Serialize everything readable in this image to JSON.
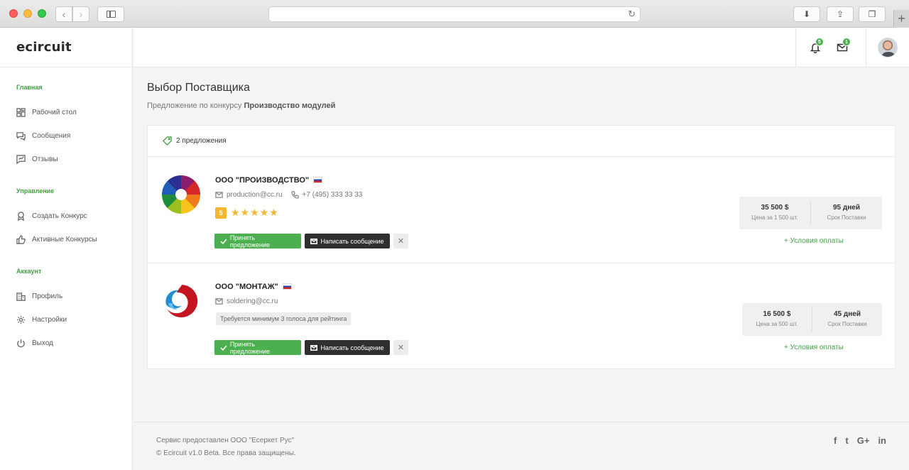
{
  "app": {
    "logo": "ecircuit"
  },
  "browser": {
    "back": "‹",
    "forward": "›",
    "reload": "↻",
    "download": "⬇",
    "share": "⇪",
    "tabs": "❐",
    "new_tab": "+"
  },
  "sidebar": {
    "sections": [
      {
        "title": "Главная",
        "items": [
          {
            "label": "Рабочий стол",
            "icon": "dashboard-icon"
          },
          {
            "label": "Сообщения",
            "icon": "chat-icon"
          },
          {
            "label": "Отзывы",
            "icon": "review-icon"
          }
        ]
      },
      {
        "title": "Управление",
        "items": [
          {
            "label": "Создать Конкурс",
            "icon": "award-icon"
          },
          {
            "label": "Активные Конкурсы",
            "icon": "thumbs-up-icon"
          }
        ]
      },
      {
        "title": "Аккаунт",
        "items": [
          {
            "label": "Профиль",
            "icon": "building-icon"
          },
          {
            "label": "Настройки",
            "icon": "gear-icon"
          },
          {
            "label": "Выход",
            "icon": "power-icon"
          }
        ]
      }
    ]
  },
  "header": {
    "notifications_count": "5",
    "messages_count": "1"
  },
  "page": {
    "title": "Выбор Поставщика",
    "subtitle_prefix": "Предложение по конкурсу",
    "subtitle_bold": "Производство модулей",
    "offers_count": "2 предложения"
  },
  "offers": [
    {
      "name": "ООО \"ПРОИЗВОДСТВО\"",
      "email": "production@cc.ru",
      "phone": "+7 (495) 333 33 33",
      "rating": "5",
      "stars": "★★★★★",
      "price": "35 500 $",
      "price_label": "Цена за 1 500 шт.",
      "term": "95 дней",
      "term_label": "Срок Поставки",
      "accept": "Принять предложение",
      "message": "Написать сообщение",
      "terms_link": "+ Условия оплаты"
    },
    {
      "name": "ООО \"МОНТАЖ\"",
      "email": "soldering@cc.ru",
      "note": "Требуется минимум 3 голоса для рейтинга",
      "price": "16 500 $",
      "price_label": "Цена за 500 шт.",
      "term": "45 дней",
      "term_label": "Срок Поставки",
      "accept": "Принять предложение",
      "message": "Написать сообщение",
      "terms_link": "+ Условия оплаты"
    }
  ],
  "footer": {
    "line1": "Сервис предоставлен ООО \"Есеркет Рус\"",
    "line2": "© Ecircuit v1.0 Beta. Все права защищены.",
    "social": [
      "f",
      "t",
      "G+",
      "in"
    ]
  },
  "colors": {
    "accent": "#4caf50",
    "dark_button": "#2f2f2f",
    "star": "#f5b731"
  }
}
